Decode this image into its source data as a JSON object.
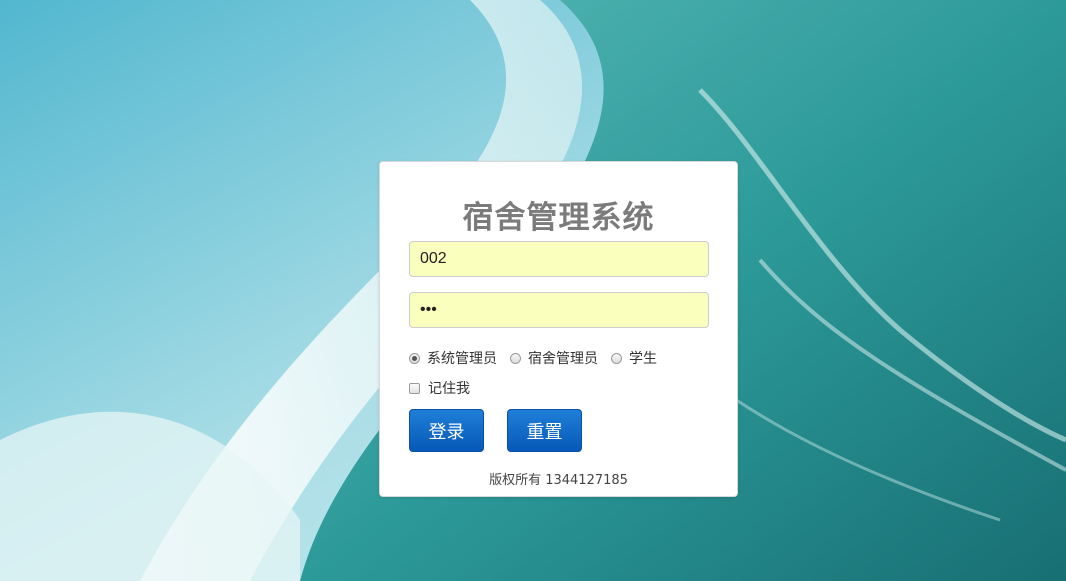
{
  "app": {
    "title": "宿舍管理系统",
    "copyright": "版权所有 1344127185"
  },
  "form": {
    "username_value": "002",
    "password_value": "123",
    "roles": [
      {
        "label": "系统管理员",
        "checked": true
      },
      {
        "label": "宿舍管理员",
        "checked": false
      },
      {
        "label": "学生",
        "checked": false
      }
    ],
    "remember_label": "记住我",
    "remember_checked": false,
    "login_label": "登录",
    "reset_label": "重置"
  },
  "colors": {
    "button_blue": "#0758b8",
    "autofill_yellow": "#faffbd",
    "title_gray": "#7b7b7b"
  }
}
